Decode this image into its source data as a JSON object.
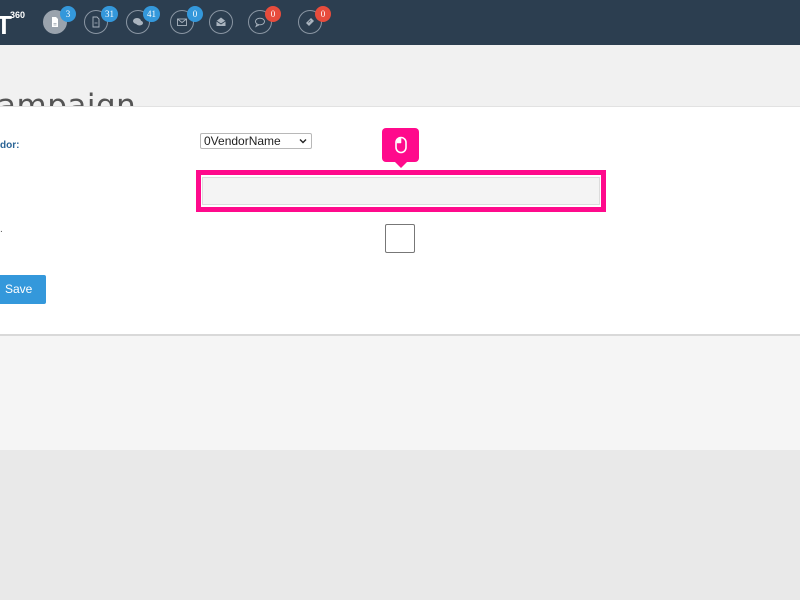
{
  "header": {
    "logo_mark": "T",
    "logo_number": "360",
    "nav_icons": [
      {
        "name": "document-icon",
        "badge": "3",
        "badge_color": "#3498db",
        "active": true
      },
      {
        "name": "invoice-icon",
        "badge": "31",
        "badge_color": "#3498db",
        "active": false
      },
      {
        "name": "chat-bubbles-icon",
        "badge": "41",
        "badge_color": "#3498db",
        "active": false
      },
      {
        "name": "envelope-icon",
        "badge": "0",
        "badge_color": "#3498db",
        "active": false
      },
      {
        "name": "open-envelope-icon",
        "badge": "",
        "badge_color": "",
        "active": false
      },
      {
        "name": "comment-icon",
        "badge": "0",
        "badge_color": "#e74c3c",
        "active": false
      },
      {
        "name": "ticket-icon",
        "badge": "0",
        "badge_color": "#e74c3c",
        "active": false
      }
    ]
  },
  "page": {
    "title": "ampaign"
  },
  "form": {
    "vendor_label": "dor:",
    "vendor_select_value": "0VendorName",
    "third_label": ".",
    "text_field_value": "",
    "checkbox_checked": false,
    "save_label": "Save"
  },
  "overlay": {
    "tooltip_icon": "mouse-icon",
    "highlight_color": "#ff0a8c"
  },
  "colors": {
    "topbar": "#2c3e50",
    "accent": "#3498db",
    "badge_red": "#e74c3c"
  }
}
